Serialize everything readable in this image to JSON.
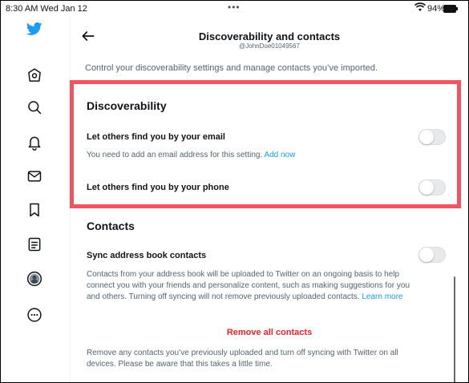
{
  "status_bar": {
    "time": "8:30 AM  Wed Jan 12",
    "dots": "•••",
    "battery": "94%"
  },
  "sidebar": {
    "items": [
      {
        "name": "home-icon"
      },
      {
        "name": "explore-icon"
      },
      {
        "name": "notifications-icon"
      },
      {
        "name": "messages-icon"
      },
      {
        "name": "bookmarks-icon"
      },
      {
        "name": "lists-icon"
      },
      {
        "name": "profile-icon"
      },
      {
        "name": "more-icon"
      }
    ],
    "brand_color": "#1d9bf0"
  },
  "header": {
    "title": "Discoverability and contacts",
    "subtitle": "@JohnDoe01049567"
  },
  "intro": "Control your discoverability settings and manage contacts you’ve imported.",
  "discoverability": {
    "title": "Discoverability",
    "email": {
      "label": "Let others find you by your email",
      "note": "You need to add an email address for this setting.",
      "link": "Add now",
      "enabled": false
    },
    "phone": {
      "label": "Let others find you by your phone",
      "enabled": false
    }
  },
  "contacts": {
    "title": "Contacts",
    "sync": {
      "label": "Sync address book contacts",
      "enabled": false,
      "desc_line1": "Contacts from your address book will be uploaded to Twitter on an ongoing basis to help",
      "desc_line2": "connect you with your friends and personalize content, such as making suggestions for you",
      "desc_line3": "and others. Turning off syncing will not remove previously uploaded contacts.",
      "learn_more": "Learn more"
    },
    "remove_label": "Remove all contacts",
    "remove_desc_line1": "Remove any contacts you’ve previously uploaded and turn off syncing with Twitter on all",
    "remove_desc_line2": "devices. Please be aware that this takes a little time."
  },
  "colors": {
    "accent": "#1d9bf0",
    "danger": "#f4212e",
    "highlight": "#f0555f"
  }
}
